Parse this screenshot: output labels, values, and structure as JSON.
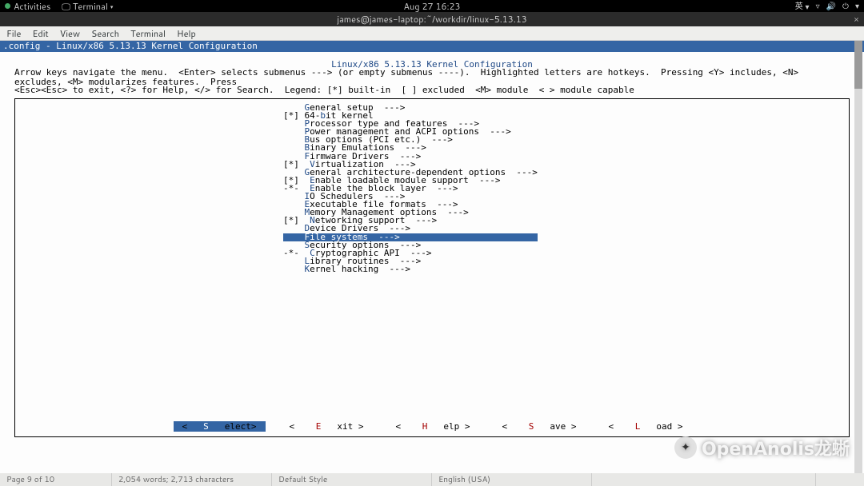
{
  "gnome": {
    "activities": "Activities",
    "app": "Terminal",
    "clock": "Aug 27  16:23",
    "lang": "英",
    "vol_icon": "🔊",
    "net_icon": "▾",
    "power_icon": "⏻",
    "arrow": "▾"
  },
  "window": {
    "title": "james@james-laptop:~/workdir/linux-5.13.13",
    "close": "×"
  },
  "menubar": [
    "File",
    "Edit",
    "View",
    "Search",
    "Terminal",
    "Help"
  ],
  "toprow": ".config - Linux/x86 5.13.13 Kernel Configuration",
  "kconf_title": "Linux/x86 5.13.13 Kernel Configuration",
  "hint1": "Arrow keys navigate the menu.  <Enter> selects submenus ---> (or empty submenus ----).  Highlighted letters are hotkeys.  Pressing <Y> includes, <N> excludes, <M> modularizes features.  Press",
  "hint2": "<Esc><Esc> to exit, <?> for Help, </> for Search.  Legend: [*] built-in  [ ] excluded  <M> module  < > module capable",
  "menu": [
    {
      "mark": "   ",
      "hot": "G",
      "rest": "eneral setup  --->"
    },
    {
      "mark": "[*]",
      "hot": " 64-",
      "hot2": "b",
      "rest": "it kernel",
      "raw": true
    },
    {
      "mark": "   ",
      "hot": "P",
      "rest": "rocessor type and features  --->"
    },
    {
      "mark": "   ",
      "hot": "P",
      "rest": "ower management and ACPI options  --->"
    },
    {
      "mark": "   ",
      "hot": "B",
      "rest": "us options (PCI etc.)  --->"
    },
    {
      "mark": "   ",
      "hot": "B",
      "rest": "inary Emulations  --->"
    },
    {
      "mark": "   ",
      "hot": "F",
      "rest": "irmware Drivers  --->"
    },
    {
      "mark": "[*]",
      "hot": " V",
      "rest": "irtualization  --->"
    },
    {
      "mark": "   ",
      "hot": "G",
      "rest": "eneral architecture-dependent options  --->"
    },
    {
      "mark": "[*]",
      "hot": " E",
      "rest": "nable loadable module support  --->"
    },
    {
      "mark": "-*-",
      "hot": " E",
      "rest": "nable the block layer  --->"
    },
    {
      "mark": "   ",
      "hot": "I",
      "rest": "O Schedulers  --->"
    },
    {
      "mark": "   ",
      "hot": "E",
      "rest": "xecutable file formats  --->"
    },
    {
      "mark": "   ",
      "hot": "M",
      "rest": "emory Management options  --->"
    },
    {
      "mark": "[*]",
      "hot": " N",
      "rest": "etworking support  --->"
    },
    {
      "mark": "   ",
      "hot": "D",
      "rest": "evice Drivers  --->"
    },
    {
      "mark": "   ",
      "hot": "F",
      "rest": "ile systems  --->",
      "selected": true
    },
    {
      "mark": "   ",
      "hot": "S",
      "rest": "ecurity options  --->"
    },
    {
      "mark": "-*-",
      "hot": " C",
      "rest": "ryptographic API  --->"
    },
    {
      "mark": "   ",
      "hot": "L",
      "rest": "ibrary routines  --->"
    },
    {
      "mark": "   ",
      "hot": "K",
      "rest": "ernel hacking  --->"
    }
  ],
  "buttons": [
    {
      "pre": "<",
      "hot": "S",
      "post": "elect>",
      "selected": true
    },
    {
      "pre": "< ",
      "hot": "E",
      "post": "xit >"
    },
    {
      "pre": "< ",
      "hot": "H",
      "post": "elp >"
    },
    {
      "pre": "< ",
      "hot": "S",
      "post": "ave >"
    },
    {
      "pre": "< ",
      "hot": "L",
      "post": "oad >"
    }
  ],
  "statusbar": {
    "page": "Page 9 of 10",
    "words": "2,054 words; 2,713 characters",
    "style": "Default Style",
    "lang": "English (USA)",
    "blank1": "",
    "blank2": ""
  },
  "watermark": "OpenAnolis龙蜥"
}
